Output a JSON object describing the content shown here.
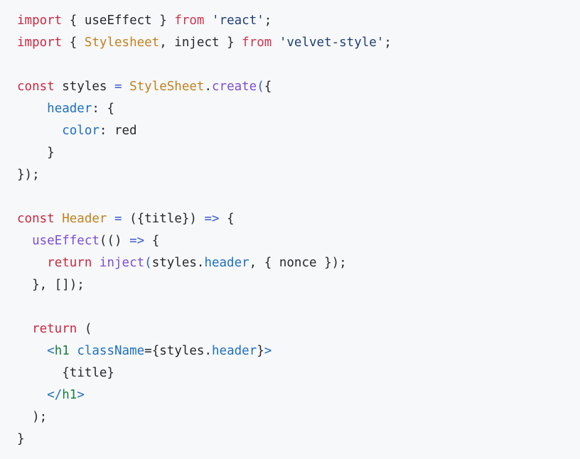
{
  "editor": {
    "background_color": "#f7f8fa",
    "language": "jsx",
    "palette": {
      "keyword": "#c92a40",
      "class_name": "#c1811d",
      "function": "#7b4fd4",
      "property": "#1d6fc0",
      "string": "#1f3f75",
      "jsx_tag": "#18803f",
      "operator": "#3a5ccc",
      "plain": "#24292e"
    }
  },
  "code": {
    "lines": [
      {
        "id": "line-1",
        "tokens": [
          {
            "t": "import",
            "c": "keyword"
          },
          {
            "t": " ",
            "c": "plain"
          },
          {
            "t": "{",
            "c": "plain"
          },
          {
            "t": " ",
            "c": "plain"
          },
          {
            "t": "useEffect",
            "c": "plain"
          },
          {
            "t": " ",
            "c": "plain"
          },
          {
            "t": "}",
            "c": "plain"
          },
          {
            "t": " ",
            "c": "plain"
          },
          {
            "t": "from",
            "c": "from"
          },
          {
            "t": " ",
            "c": "plain"
          },
          {
            "t": "'react'",
            "c": "string"
          },
          {
            "t": ";",
            "c": "plain"
          }
        ]
      },
      {
        "id": "line-2",
        "tokens": [
          {
            "t": "import",
            "c": "keyword"
          },
          {
            "t": " ",
            "c": "plain"
          },
          {
            "t": "{",
            "c": "plain"
          },
          {
            "t": " ",
            "c": "plain"
          },
          {
            "t": "Stylesheet",
            "c": "class_name"
          },
          {
            "t": ", ",
            "c": "plain"
          },
          {
            "t": "inject",
            "c": "plain"
          },
          {
            "t": " ",
            "c": "plain"
          },
          {
            "t": "}",
            "c": "plain"
          },
          {
            "t": " ",
            "c": "plain"
          },
          {
            "t": "from",
            "c": "from"
          },
          {
            "t": " ",
            "c": "plain"
          },
          {
            "t": "'velvet-style'",
            "c": "string"
          },
          {
            "t": ";",
            "c": "plain"
          }
        ]
      },
      {
        "id": "line-3",
        "tokens": []
      },
      {
        "id": "line-4",
        "tokens": [
          {
            "t": "const",
            "c": "keyword"
          },
          {
            "t": " ",
            "c": "plain"
          },
          {
            "t": "styles",
            "c": "plain"
          },
          {
            "t": " ",
            "c": "plain"
          },
          {
            "t": "=",
            "c": "operator"
          },
          {
            "t": " ",
            "c": "plain"
          },
          {
            "t": "StyleSheet",
            "c": "class_name"
          },
          {
            "t": ".",
            "c": "plain"
          },
          {
            "t": "create",
            "c": "function"
          },
          {
            "t": "(",
            "c": "operator"
          },
          {
            "t": "{",
            "c": "plain"
          }
        ]
      },
      {
        "id": "line-5",
        "tokens": [
          {
            "t": "    ",
            "c": "plain"
          },
          {
            "t": "header",
            "c": "property"
          },
          {
            "t": ": ",
            "c": "plain"
          },
          {
            "t": "{",
            "c": "plain"
          }
        ]
      },
      {
        "id": "line-6",
        "tokens": [
          {
            "t": "      ",
            "c": "plain"
          },
          {
            "t": "color",
            "c": "property"
          },
          {
            "t": ": ",
            "c": "plain"
          },
          {
            "t": "red",
            "c": "plain"
          }
        ]
      },
      {
        "id": "line-7",
        "tokens": [
          {
            "t": "    ",
            "c": "plain"
          },
          {
            "t": "}",
            "c": "plain"
          }
        ]
      },
      {
        "id": "line-8",
        "tokens": [
          {
            "t": "});",
            "c": "plain"
          }
        ]
      },
      {
        "id": "line-9",
        "tokens": []
      },
      {
        "id": "line-10",
        "tokens": [
          {
            "t": "const",
            "c": "keyword"
          },
          {
            "t": " ",
            "c": "plain"
          },
          {
            "t": "Header",
            "c": "class_name"
          },
          {
            "t": " ",
            "c": "plain"
          },
          {
            "t": "=",
            "c": "operator"
          },
          {
            "t": " ",
            "c": "plain"
          },
          {
            "t": "({",
            "c": "plain"
          },
          {
            "t": "title",
            "c": "plain"
          },
          {
            "t": "})",
            "c": "plain"
          },
          {
            "t": " ",
            "c": "plain"
          },
          {
            "t": "=>",
            "c": "operator"
          },
          {
            "t": " ",
            "c": "plain"
          },
          {
            "t": "{",
            "c": "plain"
          }
        ]
      },
      {
        "id": "line-11",
        "tokens": [
          {
            "t": "  ",
            "c": "plain"
          },
          {
            "t": "useEffect",
            "c": "function"
          },
          {
            "t": "((",
            "c": "plain"
          },
          {
            "t": ")",
            "c": "plain"
          },
          {
            "t": " ",
            "c": "plain"
          },
          {
            "t": "=>",
            "c": "operator"
          },
          {
            "t": " ",
            "c": "plain"
          },
          {
            "t": "{",
            "c": "plain"
          }
        ]
      },
      {
        "id": "line-12",
        "tokens": [
          {
            "t": "    ",
            "c": "plain"
          },
          {
            "t": "return",
            "c": "keyword"
          },
          {
            "t": " ",
            "c": "plain"
          },
          {
            "t": "inject",
            "c": "function"
          },
          {
            "t": "(",
            "c": "operator"
          },
          {
            "t": "styles",
            "c": "plain"
          },
          {
            "t": ".",
            "c": "plain"
          },
          {
            "t": "header",
            "c": "property"
          },
          {
            "t": ", ",
            "c": "plain"
          },
          {
            "t": "{",
            "c": "plain"
          },
          {
            "t": " ",
            "c": "plain"
          },
          {
            "t": "nonce",
            "c": "plain"
          },
          {
            "t": " ",
            "c": "plain"
          },
          {
            "t": "});",
            "c": "plain"
          }
        ]
      },
      {
        "id": "line-13",
        "tokens": [
          {
            "t": "  ",
            "c": "plain"
          },
          {
            "t": "}, []);",
            "c": "plain"
          }
        ]
      },
      {
        "id": "line-14",
        "tokens": []
      },
      {
        "id": "line-15",
        "tokens": [
          {
            "t": "  ",
            "c": "plain"
          },
          {
            "t": "return",
            "c": "keyword"
          },
          {
            "t": " ",
            "c": "plain"
          },
          {
            "t": "(",
            "c": "plain"
          }
        ]
      },
      {
        "id": "line-16",
        "tokens": [
          {
            "t": "    ",
            "c": "plain"
          },
          {
            "t": "<",
            "c": "jsx_punct"
          },
          {
            "t": "h1",
            "c": "jsx_tag"
          },
          {
            "t": " ",
            "c": "plain"
          },
          {
            "t": "className",
            "c": "property"
          },
          {
            "t": "=",
            "c": "plain"
          },
          {
            "t": "{",
            "c": "plain"
          },
          {
            "t": "styles",
            "c": "plain"
          },
          {
            "t": ".",
            "c": "plain"
          },
          {
            "t": "header",
            "c": "property"
          },
          {
            "t": "}",
            "c": "plain"
          },
          {
            "t": ">",
            "c": "jsx_punct"
          }
        ]
      },
      {
        "id": "line-17",
        "tokens": [
          {
            "t": "      ",
            "c": "plain"
          },
          {
            "t": "{title}",
            "c": "plain"
          }
        ]
      },
      {
        "id": "line-18",
        "tokens": [
          {
            "t": "    ",
            "c": "plain"
          },
          {
            "t": "</",
            "c": "jsx_punct"
          },
          {
            "t": "h1",
            "c": "jsx_tag"
          },
          {
            "t": ">",
            "c": "jsx_punct"
          }
        ]
      },
      {
        "id": "line-19",
        "tokens": [
          {
            "t": "  ",
            "c": "plain"
          },
          {
            "t": ");",
            "c": "plain"
          }
        ]
      },
      {
        "id": "line-20",
        "tokens": [
          {
            "t": "}",
            "c": "plain"
          }
        ]
      }
    ]
  }
}
